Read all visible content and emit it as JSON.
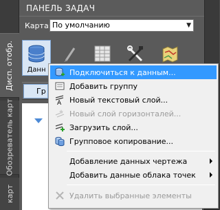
{
  "panel": {
    "title": "ПАНЕЛЬ ЗАДАЧ",
    "map_label": "Карта:",
    "map_value": "По умолчанию"
  },
  "side_tabs": [
    {
      "label": "Дисп. отобр."
    },
    {
      "label": "Обозреватель карт"
    },
    {
      "label": "карт"
    }
  ],
  "toolbar": {
    "data_button_label": "Данн",
    "icons": [
      "database-icon",
      "brush-icon",
      "table-icon",
      "tools-icon",
      "map-icon"
    ]
  },
  "layer_bar": {
    "button_label": "Гр"
  },
  "context_menu": {
    "items": [
      {
        "label": "Подключиться к данным...",
        "state": "highlighted",
        "icon": "connect-data-icon"
      },
      {
        "label": "Добавить группу",
        "state": "normal",
        "icon": "add-group-icon"
      },
      {
        "label": "Новый текстовый слой...",
        "state": "normal",
        "icon": "text-layer-icon"
      },
      {
        "label": "Новый слой горизонталей...",
        "state": "disabled",
        "icon": "contour-layer-icon"
      },
      {
        "label": "Загрузить слой...",
        "state": "normal",
        "icon": "load-layer-icon"
      },
      {
        "label": "Групповое копирование...",
        "state": "normal",
        "icon": "bulk-copy-icon"
      },
      {
        "label": "Добавление данных чертежа",
        "state": "normal",
        "submenu": true
      },
      {
        "label": "Добавить данные облака точек",
        "state": "normal",
        "submenu": true
      },
      {
        "label": "Удалить выбранные элементы",
        "state": "disabled",
        "icon": "delete-icon"
      }
    ]
  },
  "colors": {
    "highlight": "#3399ff",
    "panel_bg": "#5a5a5a",
    "menu_bg": "#f0f0f0"
  }
}
